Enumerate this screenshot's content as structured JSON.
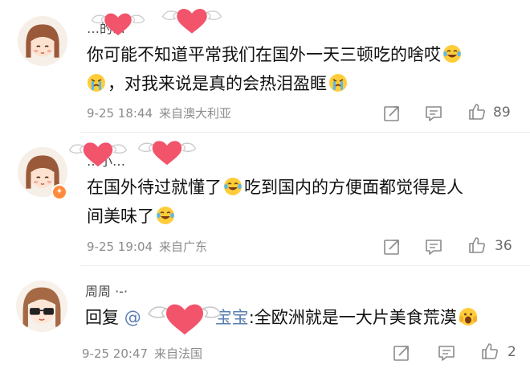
{
  "comments": [
    {
      "username": "…的…",
      "text_line1": "你可能不知道平常我们在国外一天三顿吃的啥哎",
      "text_line2": "，对我来说是真的会热泪盈眶",
      "time": "9-25 18:44",
      "location": "来自澳大利亚",
      "likes": "89"
    },
    {
      "username": "…小…",
      "text_line1_a": "在国外待过就懂了",
      "text_line1_b": "吃到国内的方便面都觉得是人",
      "text_line2": "间美味了",
      "time": "9-25 19:04",
      "location": "来自广东",
      "likes": "36"
    },
    {
      "username": "周周 ·-·",
      "reply_prefix": "回复",
      "mention": "@",
      "mention_tail": "宝宝",
      "text": ":全欧洲就是一大片美食荒漠",
      "time": "9-25 20:47",
      "location": "来自法国",
      "likes": "2"
    }
  ],
  "icons": {
    "share": "share-icon",
    "comment": "comment-icon",
    "like": "thumbs-up-icon",
    "crying_laugh": "tears-of-joy-emoji",
    "crying": "crying-emoji",
    "scream": "screaming-emoji"
  },
  "colors": {
    "meta_text": "#8c8c8c",
    "mention": "#5b7fb3",
    "redaction_heart": "#f2546c",
    "badge": "#ff8a3d"
  }
}
